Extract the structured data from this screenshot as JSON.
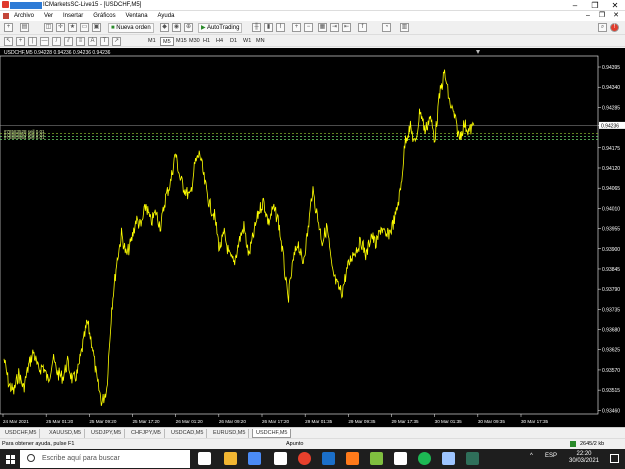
{
  "window": {
    "title": "ICMarketsSC-Live15 - [USDCHF,M5]",
    "controls": [
      "–",
      "❐",
      "✕"
    ]
  },
  "menu": {
    "items": [
      "Archivo",
      "Ver",
      "Insertar",
      "Gráficos",
      "Ventana",
      "Ayuda"
    ],
    "mdi_controls": [
      "–",
      "❐",
      "✕"
    ]
  },
  "toolbar": {
    "new_order_label": "Nueva orden",
    "autotrading_label": "AutoTrading",
    "timeframes": [
      "M1",
      "M5",
      "M15",
      "M30",
      "H1",
      "H4",
      "D1",
      "W1",
      "MN"
    ],
    "active_timeframe": "M5"
  },
  "chart": {
    "info_line": "USDCHF,M5  0.94228 0.94236 0.94236 0.94236",
    "order_lines": [
      "#78583528 sell 0.01",
      "#78583563 sell 0.01",
      "#78583564 sell 0.01"
    ],
    "current_price_label": "0.94236",
    "price_color": "#ffff00",
    "background": "#000000"
  },
  "chart_data": {
    "type": "line",
    "title": "USDCHF,M5",
    "x_ticks": [
      "24 Mar 2021",
      "25 Mar 01:20",
      "25 Mar 09:20",
      "25 Mar 17:20",
      "26 Mar 01:20",
      "26 Mar 09:20",
      "26 Mar 17:20",
      "29 Mar 01:35",
      "29 Mar 09:35",
      "29 Mar 17:35",
      "30 Mar 01:35",
      "30 Mar 09:35",
      "30 Mar 17:35"
    ],
    "y_ticks": [
      "0.94395",
      "0.94340",
      "0.94285",
      "0.94236",
      "0.94175",
      "0.94120",
      "0.94065",
      "0.94010",
      "0.93955",
      "0.93900",
      "0.93845",
      "0.93790",
      "0.93735",
      "0.93680",
      "0.93625",
      "0.93570",
      "0.93515",
      "0.93460"
    ],
    "ylim": [
      0.9345,
      0.94425
    ],
    "series": [
      {
        "color": "#ffff00",
        "x": [
          0,
          5,
          10,
          15,
          20,
          25,
          30,
          35,
          40,
          45,
          50,
          55,
          60,
          65,
          70,
          75,
          80,
          85,
          90,
          95,
          100,
          105,
          110,
          115,
          120,
          125,
          130,
          135,
          140,
          145,
          150,
          155,
          160,
          165,
          170,
          175,
          180,
          185,
          190,
          195,
          200,
          205,
          210,
          215,
          220,
          225,
          230,
          235,
          240,
          245,
          250,
          255,
          260,
          265,
          270,
          275,
          280,
          285,
          290,
          295,
          300,
          305,
          310,
          315,
          320,
          325,
          330,
          335,
          340,
          345,
          350,
          355,
          360,
          365,
          370,
          375,
          380,
          385,
          390,
          395,
          400,
          405,
          410,
          415,
          420,
          425,
          430,
          435,
          440,
          445,
          450,
          455,
          460,
          465,
          470,
          475,
          480
        ],
        "values": [
          0.936,
          0.9353,
          0.9351,
          0.9356,
          0.9352,
          0.9358,
          0.9362,
          0.9357,
          0.9358,
          0.9354,
          0.936,
          0.9356,
          0.9355,
          0.9359,
          0.9354,
          0.9356,
          0.9363,
          0.937,
          0.9364,
          0.9354,
          0.9348,
          0.9352,
          0.9374,
          0.9386,
          0.9394,
          0.9388,
          0.9392,
          0.9398,
          0.9396,
          0.9402,
          0.9397,
          0.94,
          0.9396,
          0.9404,
          0.9408,
          0.9416,
          0.9409,
          0.9406,
          0.9404,
          0.9413,
          0.9416,
          0.9408,
          0.9402,
          0.9399,
          0.939,
          0.9394,
          0.9388,
          0.9386,
          0.9392,
          0.9396,
          0.9388,
          0.9394,
          0.94,
          0.9403,
          0.9397,
          0.9401,
          0.9398,
          0.9388,
          0.9376,
          0.9386,
          0.9392,
          0.9386,
          0.9394,
          0.9406,
          0.9399,
          0.9392,
          0.9396,
          0.9384,
          0.938,
          0.9378,
          0.9384,
          0.9388,
          0.939,
          0.9392,
          0.9388,
          0.9394,
          0.9391,
          0.9396,
          0.9393,
          0.9395,
          0.9399,
          0.9406,
          0.942,
          0.9423,
          0.9418,
          0.9428,
          0.9422,
          0.9426,
          0.942,
          0.9432,
          0.9438,
          0.943,
          0.9426,
          0.942,
          0.9424,
          0.9422,
          0.94236
        ]
      }
    ]
  },
  "tabs": {
    "items": [
      "USDCHF,M5",
      "XAUUSD,M5",
      "USDJPY,M5",
      "CHFJPY,M5",
      "USDCAD,M5",
      "EURUSD,M5",
      "USDCHF,M5"
    ],
    "active_index": 6
  },
  "status": {
    "help_text": "Para obtener ayuda, pulse F1",
    "profile": "Apunto",
    "traffic": "2645/2 kb"
  },
  "taskbar": {
    "search_placeholder": "Escribe aquí para buscar",
    "time": "22:20",
    "date": "30/03/2021",
    "tray_glyphs": [
      "^",
      "ESP"
    ],
    "app_colors": [
      "#ffffff",
      "#f2b632",
      "#4b8bf5",
      "#ffffff",
      "#e8402c",
      "#1b6fc9",
      "#ff7a1a",
      "#7fbf3f",
      "#ffffff",
      "#1db954",
      "#9ec5ff",
      "#2f6f5a"
    ]
  }
}
